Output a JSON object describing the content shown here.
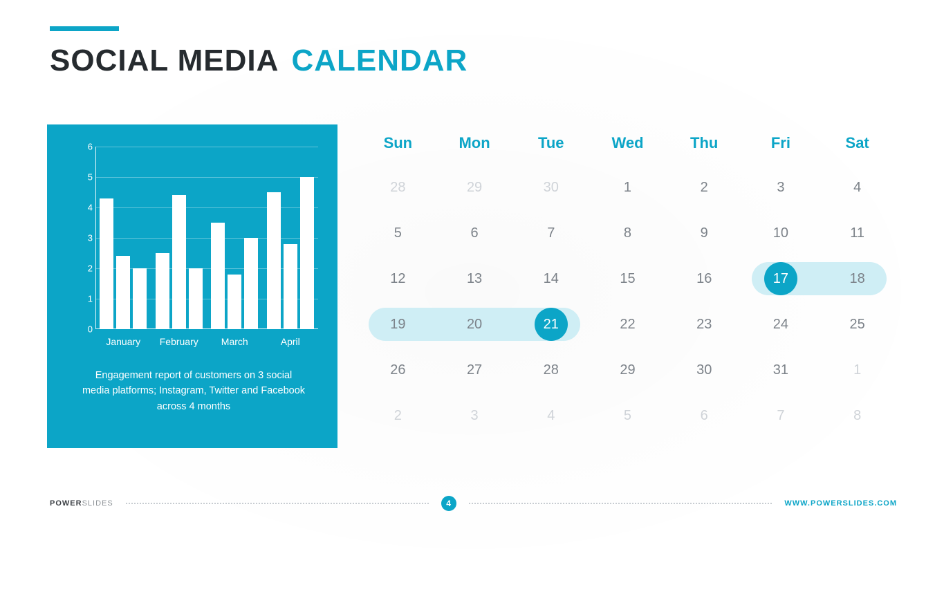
{
  "accent": "#0ca5c7",
  "title": {
    "part1": "SOCIAL MEDIA",
    "part2": "CALENDAR"
  },
  "chart_data": {
    "type": "bar",
    "categories": [
      "January",
      "February",
      "March",
      "April"
    ],
    "series": [
      {
        "name": "Instagram",
        "values": [
          4.3,
          2.5,
          3.5,
          4.5
        ]
      },
      {
        "name": "Twitter",
        "values": [
          2.4,
          4.4,
          1.8,
          2.8
        ]
      },
      {
        "name": "Facebook",
        "values": [
          2.0,
          2.0,
          3.0,
          5.0
        ]
      }
    ],
    "ylim": [
      0,
      6
    ],
    "yticks": [
      0,
      1,
      2,
      3,
      4,
      5,
      6
    ],
    "xlabel": "",
    "ylabel": "",
    "title": "",
    "caption": "Engagement report of customers on 3 social media platforms; Instagram, Twitter and Facebook across 4 months"
  },
  "calendar": {
    "dow": [
      "Sun",
      "Mon",
      "Tue",
      "Wed",
      "Thu",
      "Fri",
      "Sat"
    ],
    "weeks": [
      [
        {
          "d": "28",
          "o": true
        },
        {
          "d": "29",
          "o": true
        },
        {
          "d": "30",
          "o": true
        },
        {
          "d": "1"
        },
        {
          "d": "2"
        },
        {
          "d": "3"
        },
        {
          "d": "4"
        }
      ],
      [
        {
          "d": "5"
        },
        {
          "d": "6"
        },
        {
          "d": "7"
        },
        {
          "d": "8"
        },
        {
          "d": "9"
        },
        {
          "d": "10"
        },
        {
          "d": "11"
        }
      ],
      [
        {
          "d": "12"
        },
        {
          "d": "13"
        },
        {
          "d": "14"
        },
        {
          "d": "15"
        },
        {
          "d": "16"
        },
        {
          "d": "17",
          "sel": true
        },
        {
          "d": "18"
        }
      ],
      [
        {
          "d": "19"
        },
        {
          "d": "20"
        },
        {
          "d": "21",
          "sel": true
        },
        {
          "d": "22"
        },
        {
          "d": "23"
        },
        {
          "d": "24"
        },
        {
          "d": "25"
        }
      ],
      [
        {
          "d": "26"
        },
        {
          "d": "27"
        },
        {
          "d": "28"
        },
        {
          "d": "29"
        },
        {
          "d": "30"
        },
        {
          "d": "31"
        },
        {
          "d": "1",
          "o": true
        }
      ],
      [
        {
          "d": "2",
          "o": true
        },
        {
          "d": "3",
          "o": true
        },
        {
          "d": "4",
          "o": true
        },
        {
          "d": "5",
          "o": true
        },
        {
          "d": "6",
          "o": true
        },
        {
          "d": "7",
          "o": true
        },
        {
          "d": "8",
          "o": true
        }
      ]
    ],
    "ranges": [
      {
        "week": 2,
        "startCol": 5,
        "endCol": 6,
        "dotCol": 5
      },
      {
        "week": 3,
        "startCol": 0,
        "endCol": 2,
        "dotCol": 2
      }
    ]
  },
  "footer": {
    "brand1": "POWER",
    "brand2": "SLIDES",
    "page": "4",
    "url": "WWW.POWERSLIDES.COM"
  }
}
